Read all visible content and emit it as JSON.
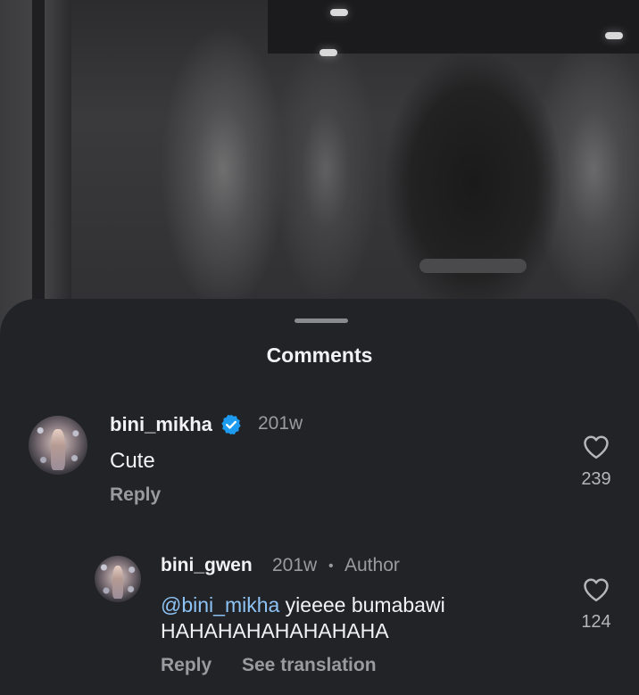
{
  "sheet": {
    "title": "Comments"
  },
  "comments": [
    {
      "username": "bini_mikha",
      "verified": true,
      "time": "201w",
      "text": "Cute",
      "reply_label": "Reply",
      "likes": "239"
    }
  ],
  "replies": [
    {
      "username": "bini_gwen",
      "time": "201w",
      "separator": "•",
      "author_badge": "Author",
      "mention": "@bini_mikha",
      "text_line1": " yieeee bumabawi",
      "text_line2": "HAHAHAHAHAHAHAHA",
      "reply_label": "Reply",
      "translation_label": "See translation",
      "likes": "124"
    }
  ],
  "icons": {
    "verified": "verified-badge-icon",
    "like": "heart-icon"
  },
  "colors": {
    "sheet_bg": "#222326",
    "verified": "#1d9bf0",
    "mention": "#8ec4f5",
    "secondary_text": "#9a9ba0"
  }
}
